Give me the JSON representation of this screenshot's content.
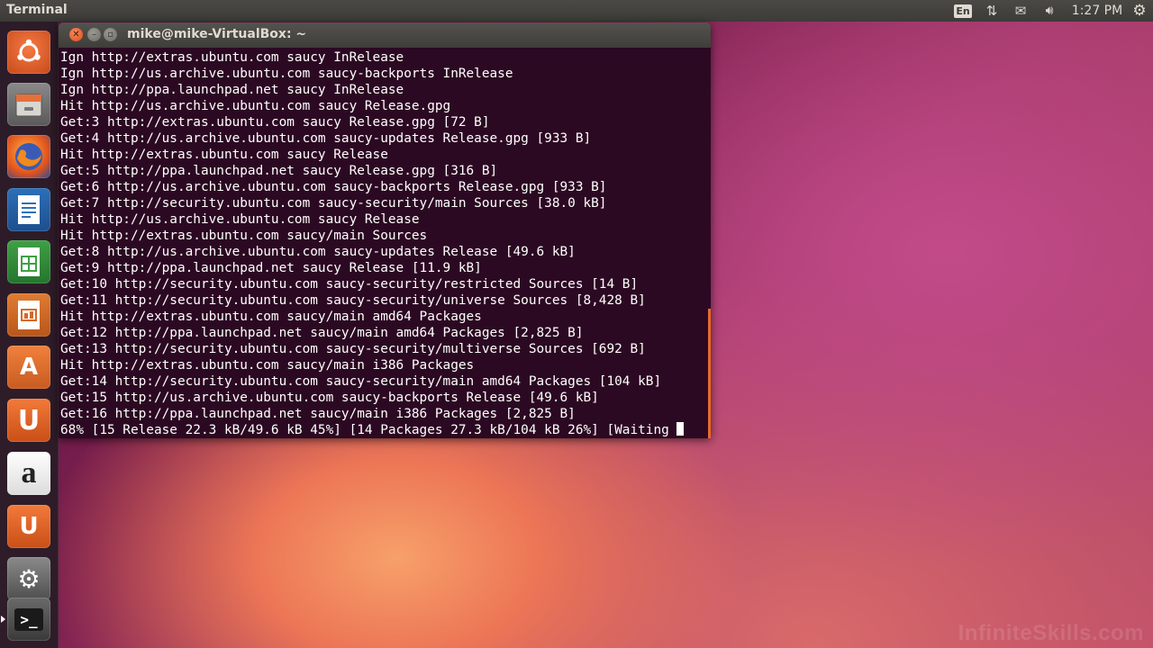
{
  "top_panel": {
    "app_title": "Terminal",
    "keyboard_layout": "En",
    "clock": "1:27 PM"
  },
  "launcher": {
    "items": [
      {
        "name": "dash-home",
        "icon": "ubuntu-logo-icon"
      },
      {
        "name": "files",
        "icon": "file-cabinet-icon"
      },
      {
        "name": "firefox",
        "icon": "firefox-icon"
      },
      {
        "name": "libreoffice-writer",
        "icon": "document-icon"
      },
      {
        "name": "libreoffice-calc",
        "icon": "spreadsheet-icon"
      },
      {
        "name": "libreoffice-impress",
        "icon": "presentation-icon"
      },
      {
        "name": "software-center",
        "icon": "shopping-bag-icon",
        "glyph": "A"
      },
      {
        "name": "ubuntu-one",
        "icon": "ubuntu-one-icon",
        "glyph": "U"
      },
      {
        "name": "amazon",
        "icon": "amazon-icon",
        "glyph": "a"
      },
      {
        "name": "ubuntu-one-music",
        "icon": "headphones-icon",
        "glyph": "U"
      },
      {
        "name": "system-settings",
        "icon": "wrench-gear-icon"
      },
      {
        "name": "terminal",
        "icon": "terminal-icon",
        "glyph": ">_"
      }
    ]
  },
  "terminal": {
    "window_title": "mike@mike-VirtualBox: ~",
    "lines": [
      "Ign http://extras.ubuntu.com saucy InRelease",
      "Ign http://us.archive.ubuntu.com saucy-backports InRelease",
      "Ign http://ppa.launchpad.net saucy InRelease",
      "Hit http://us.archive.ubuntu.com saucy Release.gpg",
      "Get:3 http://extras.ubuntu.com saucy Release.gpg [72 B]",
      "Get:4 http://us.archive.ubuntu.com saucy-updates Release.gpg [933 B]",
      "Hit http://extras.ubuntu.com saucy Release",
      "Get:5 http://ppa.launchpad.net saucy Release.gpg [316 B]",
      "Get:6 http://us.archive.ubuntu.com saucy-backports Release.gpg [933 B]",
      "Get:7 http://security.ubuntu.com saucy-security/main Sources [38.0 kB]",
      "Hit http://us.archive.ubuntu.com saucy Release",
      "Hit http://extras.ubuntu.com saucy/main Sources",
      "Get:8 http://us.archive.ubuntu.com saucy-updates Release [49.6 kB]",
      "Get:9 http://ppa.launchpad.net saucy Release [11.9 kB]",
      "Get:10 http://security.ubuntu.com saucy-security/restricted Sources [14 B]",
      "Get:11 http://security.ubuntu.com saucy-security/universe Sources [8,428 B]",
      "Hit http://extras.ubuntu.com saucy/main amd64 Packages",
      "Get:12 http://ppa.launchpad.net saucy/main amd64 Packages [2,825 B]",
      "Get:13 http://security.ubuntu.com saucy-security/multiverse Sources [692 B]",
      "Hit http://extras.ubuntu.com saucy/main i386 Packages",
      "Get:14 http://security.ubuntu.com saucy-security/main amd64 Packages [104 kB]",
      "Get:15 http://us.archive.ubuntu.com saucy-backports Release [49.6 kB]",
      "Get:16 http://ppa.launchpad.net saucy/main i386 Packages [2,825 B]"
    ],
    "progress_line": "68% [15 Release 22.3 kB/49.6 kB 45%] [14 Packages 27.3 kB/104 kB 26%] [Waiting "
  },
  "watermark": "InfiniteSkills.com"
}
